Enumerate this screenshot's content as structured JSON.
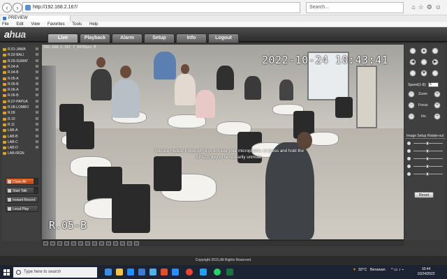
{
  "browser": {
    "address": "http://192.168.2.167/",
    "search_placeholder": "Search...",
    "tab_title": "PREVIEW",
    "menu": [
      "File",
      "Edit",
      "View",
      "Favorites",
      "Tools",
      "Help"
    ]
  },
  "app": {
    "logo_a": "a",
    "logo_rest": "hua",
    "tabs": [
      "Live",
      "Playback",
      "Alarm",
      "Setup",
      "Info",
      "Logout"
    ],
    "active_tab": "Live"
  },
  "channels": [
    {
      "name": "R.01-JAWA",
      "mode": "M"
    },
    {
      "name": "R.02-BALI",
      "mode": "M"
    },
    {
      "name": "R.03-SUMAT",
      "mode": "M"
    },
    {
      "name": "R.04-A",
      "mode": "M"
    },
    {
      "name": "R.04-B",
      "mode": "M"
    },
    {
      "name": "R.05-A",
      "mode": "M"
    },
    {
      "name": "R.05-B",
      "mode": "M"
    },
    {
      "name": "R.06-A",
      "mode": "M"
    },
    {
      "name": "R.06-B",
      "mode": "M"
    },
    {
      "name": "R.07-PAPUA",
      "mode": "M"
    },
    {
      "name": "R.08-LOMBO",
      "mode": "M"
    },
    {
      "name": "R.09",
      "mode": "M"
    },
    {
      "name": "R.10",
      "mode": "M"
    },
    {
      "name": "R.11",
      "mode": "M"
    },
    {
      "name": "LAB-A",
      "mode": "M"
    },
    {
      "name": "LAB-B",
      "mode": "M"
    },
    {
      "name": "LAB-C",
      "mode": "M"
    },
    {
      "name": "LAB-D",
      "mode": "M"
    },
    {
      "name": "LAB-IRGN",
      "mode": ""
    }
  ],
  "left_buttons": {
    "close_all": "Close All",
    "start_talk": "Start Talk",
    "instant_record": "Instant Record",
    "local_play": "Local Play"
  },
  "video": {
    "stream_info": "192.168.2.167_7_997Kbps_M",
    "timestamp": "2022-10-24  10:43:41",
    "camera_name": "R.05-B",
    "mute_notice": "You are muted. Press Alt+A to unmute your microphone, or press and hold the SPACE key to temporarily unmute."
  },
  "ptz": {
    "speed_label": "Speed(1-8):",
    "speed_value": "5",
    "zoom_label": "Zoom",
    "focus_label": "Focus",
    "iris_label": "Iris"
  },
  "image_setup": {
    "tab1": "Image Setup",
    "tab2": "Rotate-out",
    "reset_label": "Reset"
  },
  "footer": {
    "copyright": "Copyright 2015,All Rights Reserved."
  },
  "taskbar": {
    "search_placeholder": "Type here to search",
    "temperature": "32°C",
    "weather": "Berawan",
    "time": "10:44",
    "date": "10/24/2022"
  },
  "colors": {
    "accent_orange": "#e06a2a",
    "panel_bg": "#3f3f3f",
    "taskbar_bg": "#1c2434"
  }
}
